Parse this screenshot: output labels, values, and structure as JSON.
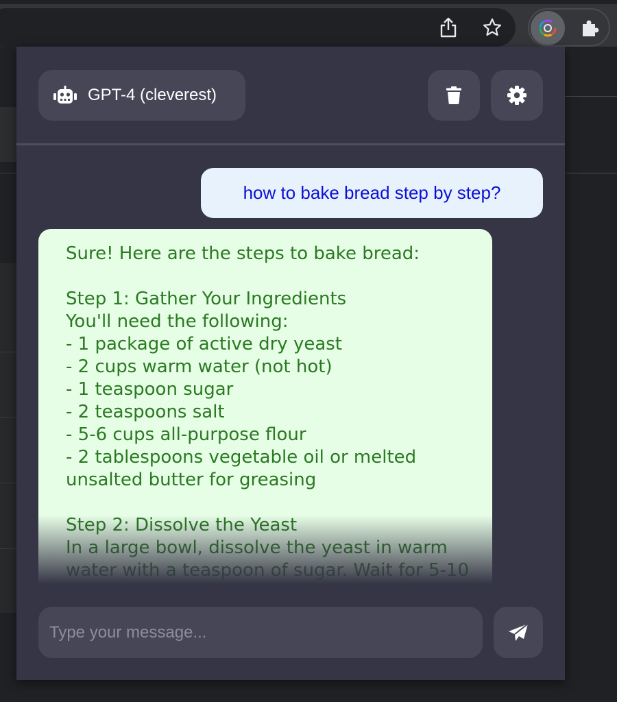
{
  "browser": {
    "share_icon": "share-icon",
    "bookmark_icon": "star-icon",
    "extension_icon": "openai-logo-icon",
    "extensions_menu_icon": "puzzle-icon"
  },
  "popup": {
    "model_label": "GPT-4 (cleverest)",
    "model_icon": "robot-icon",
    "delete_icon": "trash-icon",
    "settings_icon": "gear-icon",
    "user_message": "how to bake bread step by step?",
    "assistant_lines": [
      "Sure! Here are the steps to bake bread:",
      "",
      "Step 1: Gather Your Ingredients",
      "You'll need the following:",
      "- 1 package of active dry yeast",
      "- 2 cups warm water (not hot)",
      "- 1 teaspoon sugar",
      "- 2 teaspoons salt",
      "- 5-6 cups all-purpose flour",
      "- 2 tablespoons vegetable oil or melted",
      "unsalted butter for greasing",
      "",
      "Step 2: Dissolve the Yeast",
      "In a large bowl, dissolve the yeast in warm",
      "water with a teaspoon of sugar. Wait for 5-10"
    ],
    "input_placeholder": "Type your message...",
    "send_icon": "send-icon"
  },
  "colors": {
    "popup_bg": "#353545",
    "button_bg": "#464657",
    "user_bubble": "#e8f2fd",
    "user_text": "#0b10d6",
    "assistant_bubble": "#e6fde6",
    "assistant_text": "#2a7a21"
  }
}
